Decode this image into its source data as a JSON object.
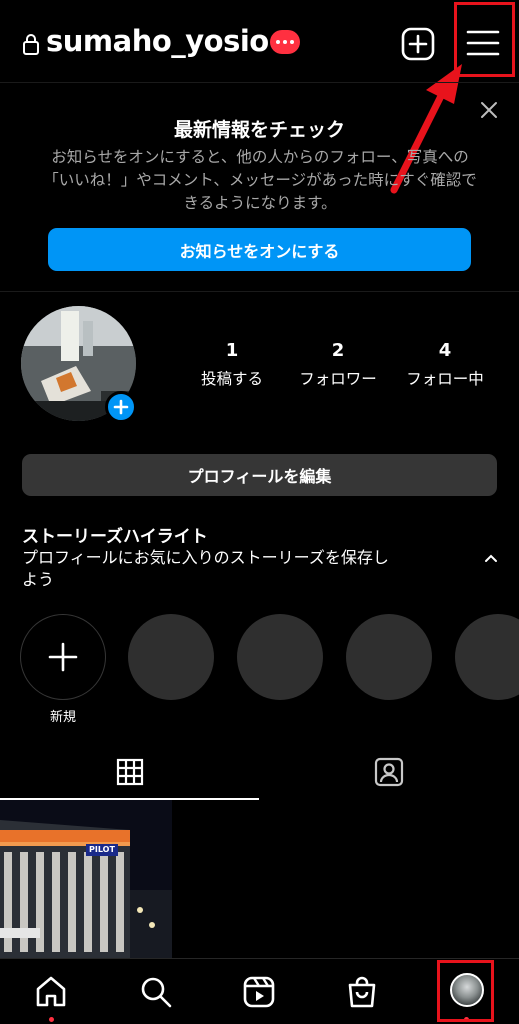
{
  "header": {
    "username": "sumaho_yosio",
    "badge_icon": "more-dots-icon",
    "new_post_icon": "plus-square-icon",
    "menu_icon": "hamburger-menu-icon"
  },
  "notice": {
    "title": "最新情報をチェック",
    "body": "お知らせをオンにすると、他の人からのフォロー、写真への「いいね！」やコメント、メッセージがあった時にすぐ確認できるようになります。",
    "button_label": "お知らせをオンにする"
  },
  "profile": {
    "stats": [
      {
        "value": "1",
        "label": "投稿する"
      },
      {
        "value": "2",
        "label": "フォロワー"
      },
      {
        "value": "4",
        "label": "フォロー中"
      }
    ],
    "edit_label": "プロフィールを編集"
  },
  "highlights": {
    "title": "ストーリーズハイライト",
    "description": "プロフィールにお気に入りのストーリーズを保存しよう",
    "new_label": "新規"
  },
  "post_sign_text": "PILOT",
  "colors": {
    "accent_blue": "#0095f6",
    "badge_red": "#ff3040",
    "annotation_red": "#e8131c",
    "button_gray": "#363636"
  },
  "bottom_nav": {
    "items": [
      "home-icon",
      "search-icon",
      "reels-icon",
      "shop-icon",
      "profile-avatar"
    ]
  }
}
